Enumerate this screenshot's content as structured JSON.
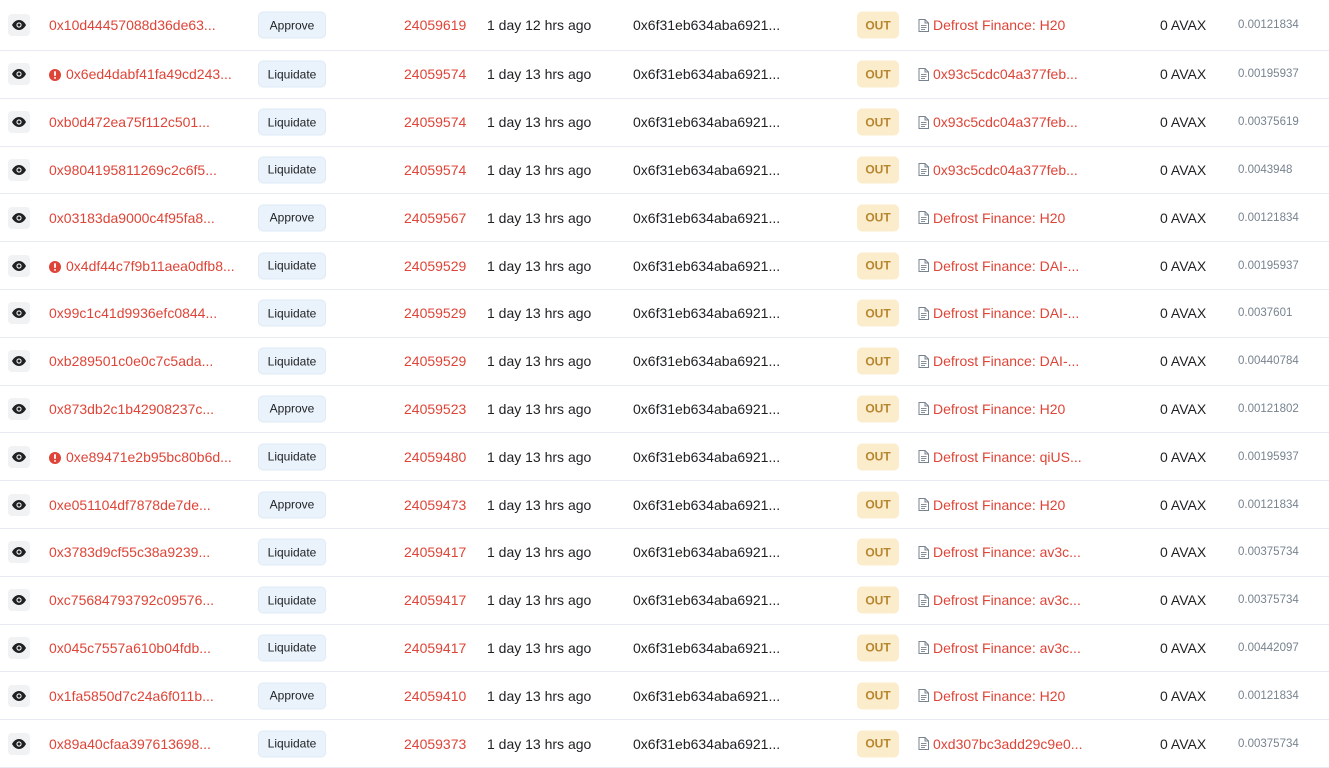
{
  "transactions": [
    {
      "hash": "0x10d44457088d36de63...",
      "error": false,
      "method": "Approve",
      "block": "24059619",
      "age": "1 day 12 hrs ago",
      "from": "0x6f31eb634aba6921...",
      "direction": "OUT",
      "to": "Defrost Finance: H20",
      "value": "0 AVAX",
      "fee": "0.00121834"
    },
    {
      "hash": "0x6ed4dabf41fa49cd243...",
      "error": true,
      "method": "Liquidate",
      "block": "24059574",
      "age": "1 day 13 hrs ago",
      "from": "0x6f31eb634aba6921...",
      "direction": "OUT",
      "to": "0x93c5cdc04a377feb...",
      "value": "0 AVAX",
      "fee": "0.00195937"
    },
    {
      "hash": "0xb0d472ea75f112c501...",
      "error": false,
      "method": "Liquidate",
      "block": "24059574",
      "age": "1 day 13 hrs ago",
      "from": "0x6f31eb634aba6921...",
      "direction": "OUT",
      "to": "0x93c5cdc04a377feb...",
      "value": "0 AVAX",
      "fee": "0.00375619"
    },
    {
      "hash": "0x9804195811269c2c6f5...",
      "error": false,
      "method": "Liquidate",
      "block": "24059574",
      "age": "1 day 13 hrs ago",
      "from": "0x6f31eb634aba6921...",
      "direction": "OUT",
      "to": "0x93c5cdc04a377feb...",
      "value": "0 AVAX",
      "fee": "0.0043948"
    },
    {
      "hash": "0x03183da9000c4f95fa8...",
      "error": false,
      "method": "Approve",
      "block": "24059567",
      "age": "1 day 13 hrs ago",
      "from": "0x6f31eb634aba6921...",
      "direction": "OUT",
      "to": "Defrost Finance: H20",
      "value": "0 AVAX",
      "fee": "0.00121834"
    },
    {
      "hash": "0x4df44c7f9b11aea0dfb8...",
      "error": true,
      "method": "Liquidate",
      "block": "24059529",
      "age": "1 day 13 hrs ago",
      "from": "0x6f31eb634aba6921...",
      "direction": "OUT",
      "to": "Defrost Finance: DAI-...",
      "value": "0 AVAX",
      "fee": "0.00195937"
    },
    {
      "hash": "0x99c1c41d9936efc0844...",
      "error": false,
      "method": "Liquidate",
      "block": "24059529",
      "age": "1 day 13 hrs ago",
      "from": "0x6f31eb634aba6921...",
      "direction": "OUT",
      "to": "Defrost Finance: DAI-...",
      "value": "0 AVAX",
      "fee": "0.0037601"
    },
    {
      "hash": "0xb289501c0e0c7c5ada...",
      "error": false,
      "method": "Liquidate",
      "block": "24059529",
      "age": "1 day 13 hrs ago",
      "from": "0x6f31eb634aba6921...",
      "direction": "OUT",
      "to": "Defrost Finance: DAI-...",
      "value": "0 AVAX",
      "fee": "0.00440784"
    },
    {
      "hash": "0x873db2c1b42908237c...",
      "error": false,
      "method": "Approve",
      "block": "24059523",
      "age": "1 day 13 hrs ago",
      "from": "0x6f31eb634aba6921...",
      "direction": "OUT",
      "to": "Defrost Finance: H20",
      "value": "0 AVAX",
      "fee": "0.00121802"
    },
    {
      "hash": "0xe89471e2b95bc80b6d...",
      "error": true,
      "method": "Liquidate",
      "block": "24059480",
      "age": "1 day 13 hrs ago",
      "from": "0x6f31eb634aba6921...",
      "direction": "OUT",
      "to": "Defrost Finance: qiUS...",
      "value": "0 AVAX",
      "fee": "0.00195937"
    },
    {
      "hash": "0xe051104df7878de7de...",
      "error": false,
      "method": "Approve",
      "block": "24059473",
      "age": "1 day 13 hrs ago",
      "from": "0x6f31eb634aba6921...",
      "direction": "OUT",
      "to": "Defrost Finance: H20",
      "value": "0 AVAX",
      "fee": "0.00121834"
    },
    {
      "hash": "0x3783d9cf55c38a9239...",
      "error": false,
      "method": "Liquidate",
      "block": "24059417",
      "age": "1 day 13 hrs ago",
      "from": "0x6f31eb634aba6921...",
      "direction": "OUT",
      "to": "Defrost Finance: av3c...",
      "value": "0 AVAX",
      "fee": "0.00375734"
    },
    {
      "hash": "0xc75684793792c09576...",
      "error": false,
      "method": "Liquidate",
      "block": "24059417",
      "age": "1 day 13 hrs ago",
      "from": "0x6f31eb634aba6921...",
      "direction": "OUT",
      "to": "Defrost Finance: av3c...",
      "value": "0 AVAX",
      "fee": "0.00375734"
    },
    {
      "hash": "0x045c7557a610b04fdb...",
      "error": false,
      "method": "Liquidate",
      "block": "24059417",
      "age": "1 day 13 hrs ago",
      "from": "0x6f31eb634aba6921...",
      "direction": "OUT",
      "to": "Defrost Finance: av3c...",
      "value": "0 AVAX",
      "fee": "0.00442097"
    },
    {
      "hash": "0x1fa5850d7c24a6f011b...",
      "error": false,
      "method": "Approve",
      "block": "24059410",
      "age": "1 day 13 hrs ago",
      "from": "0x6f31eb634aba6921...",
      "direction": "OUT",
      "to": "Defrost Finance: H20",
      "value": "0 AVAX",
      "fee": "0.00121834"
    },
    {
      "hash": "0x89a40cfaa397613698...",
      "error": false,
      "method": "Liquidate",
      "block": "24059373",
      "age": "1 day 13 hrs ago",
      "from": "0x6f31eb634aba6921...",
      "direction": "OUT",
      "to": "0xd307bc3add29c9e0...",
      "value": "0 AVAX",
      "fee": "0.00375734"
    }
  ],
  "icons": {
    "view": "eye-icon",
    "error": "error-circle-icon",
    "contract": "contract-doc-icon"
  },
  "colors": {
    "link": "#de4437",
    "out_badge_bg": "#fbeccc",
    "out_badge_text": "#b7862e",
    "method_badge_bg": "#eaf3fb"
  }
}
